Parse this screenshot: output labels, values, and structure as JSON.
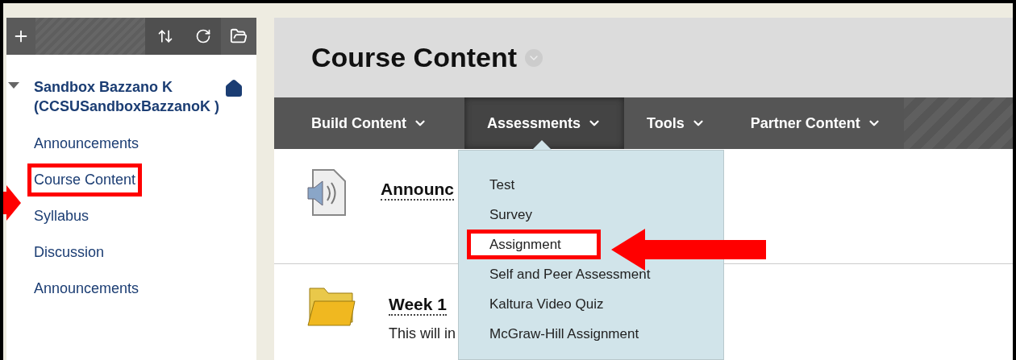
{
  "sidebar": {
    "toolbar": [
      {
        "kind": "add"
      },
      {
        "kind": "sort"
      },
      {
        "kind": "refresh"
      },
      {
        "kind": "folder"
      }
    ],
    "course_title": "Sandbox Bazzano K (CCSUSandboxBazzanoK )",
    "items": [
      {
        "label": "Announcements",
        "highlighted": false
      },
      {
        "label": "Course Content",
        "highlighted": true
      },
      {
        "label": "Syllabus",
        "highlighted": false
      },
      {
        "label": "Discussion",
        "highlighted": false
      },
      {
        "label": "Announcements",
        "highlighted": false
      }
    ]
  },
  "page_title": "Course Content",
  "nav": [
    {
      "label": "Build Content",
      "selected": false
    },
    {
      "label": "Assessments",
      "selected": true
    },
    {
      "label": "Tools",
      "selected": false
    },
    {
      "label": "Partner Content",
      "selected": false
    }
  ],
  "menu": [
    {
      "label": "Test",
      "highlighted": false
    },
    {
      "label": "Survey",
      "highlighted": false
    },
    {
      "label": "Assignment",
      "highlighted": true
    },
    {
      "label": "Self and Peer Assessment",
      "highlighted": false
    },
    {
      "label": "Kaltura Video Quiz",
      "highlighted": false
    },
    {
      "label": "McGraw-Hill Assignment",
      "highlighted": false
    }
  ],
  "content": [
    {
      "kind": "audio",
      "title": "Announc"
    },
    {
      "kind": "folder",
      "title": "Week 1",
      "description": "This will in"
    }
  ]
}
